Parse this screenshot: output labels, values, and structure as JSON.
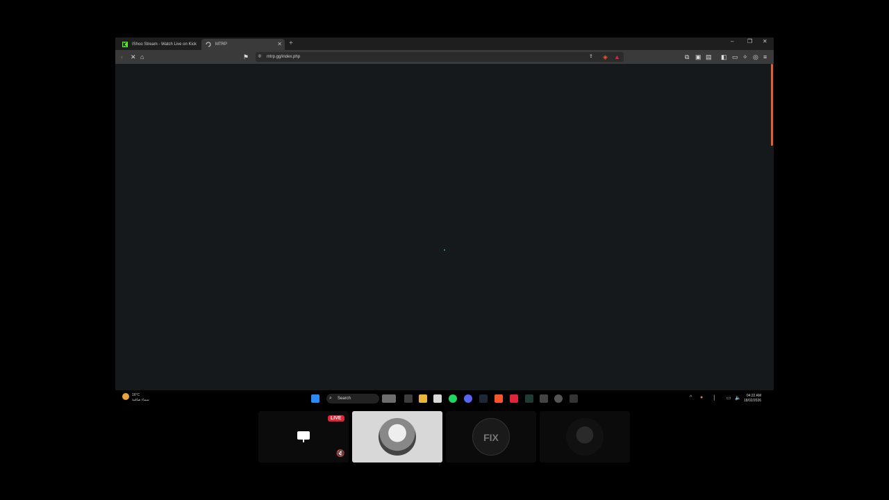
{
  "browser": {
    "tabs": [
      {
        "label": "IShoo Stream - Watch Live on Kick",
        "icon": "kick-icon",
        "active": false
      },
      {
        "label": "MTRP",
        "icon": "loading-icon",
        "active": true
      }
    ],
    "new_tab_label": "+",
    "url": "mtrp.gg/index.php",
    "accent_color": "#e05f2a",
    "loading_color": "#2bb39a"
  },
  "taskbar": {
    "weather_temp": "16°C",
    "weather_desc": "سماء صافية",
    "search_placeholder": "Search",
    "time": "04:22 AM",
    "date": "18/02/2026"
  },
  "stream_overlay": {
    "live_badge": "LIVE",
    "tiles": [
      {
        "name": "screen-share-tile",
        "active": false
      },
      {
        "name": "participant-avatar",
        "active": true
      },
      {
        "name": "fix-logo-tile",
        "active": false
      },
      {
        "name": "dark-avatar-tile",
        "active": false
      }
    ]
  }
}
